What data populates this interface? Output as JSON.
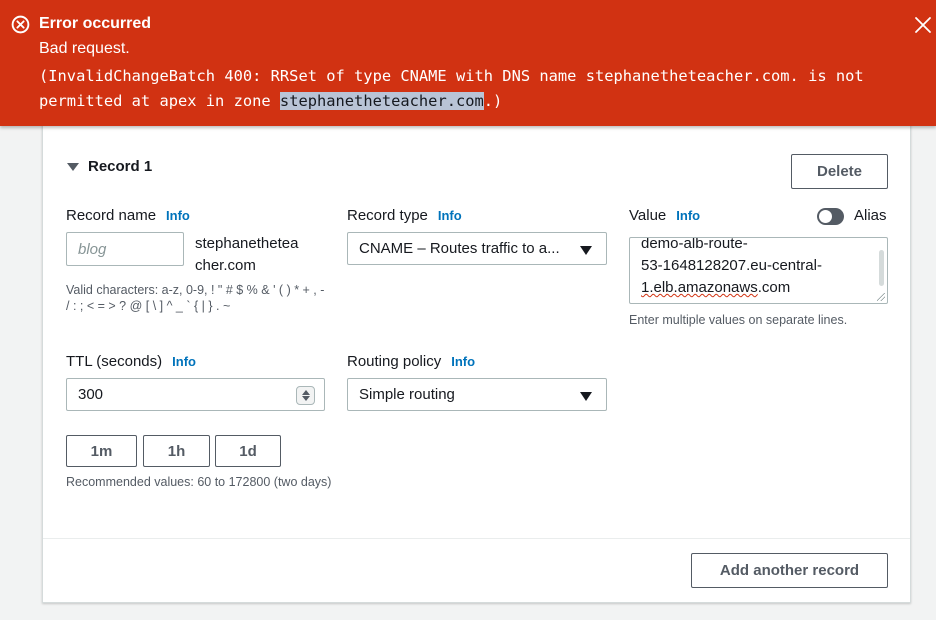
{
  "banner": {
    "title": "Error occurred",
    "subtitle": "Bad request.",
    "message_before": "(InvalidChangeBatch 400: RRSet of type CNAME with DNS name stephanetheteacher.com. is not permitted at apex in zone ",
    "message_highlight": "stephanetheteacher.com",
    "message_after": ".)"
  },
  "record": {
    "heading": "Record 1",
    "delete_label": "Delete",
    "record_name": {
      "label": "Record name",
      "info": "Info",
      "placeholder": "blog",
      "suffix": "stephanethetea cher.com",
      "hint": "Valid characters: a-z, 0-9, ! \" # $ % & ' ( ) * + , - / : ; < = > ? @ [ \\ ] ^ _ ` { | } . ~"
    },
    "record_type": {
      "label": "Record type",
      "info": "Info",
      "value": "CNAME – Routes traffic to a..."
    },
    "value": {
      "label": "Value",
      "info": "Info",
      "line1": "demo-alb-route-",
      "line2": "53-1648128207.eu-central-",
      "line3_spelled": "1.elb.amazonaws",
      "line3_rest": ".com",
      "hint": "Enter multiple values on separate lines."
    },
    "alias": {
      "label": "Alias",
      "enabled": false
    },
    "ttl": {
      "label": "TTL (seconds)",
      "info": "Info",
      "value": "300",
      "presets": [
        "1m",
        "1h",
        "1d"
      ],
      "hint": "Recommended values: 60 to 172800 (two days)"
    },
    "routing_policy": {
      "label": "Routing policy",
      "info": "Info",
      "value": "Simple routing"
    }
  },
  "footer": {
    "add_label": "Add another record"
  },
  "colors": {
    "error": "#d13212",
    "info_link": "#0073bb"
  }
}
